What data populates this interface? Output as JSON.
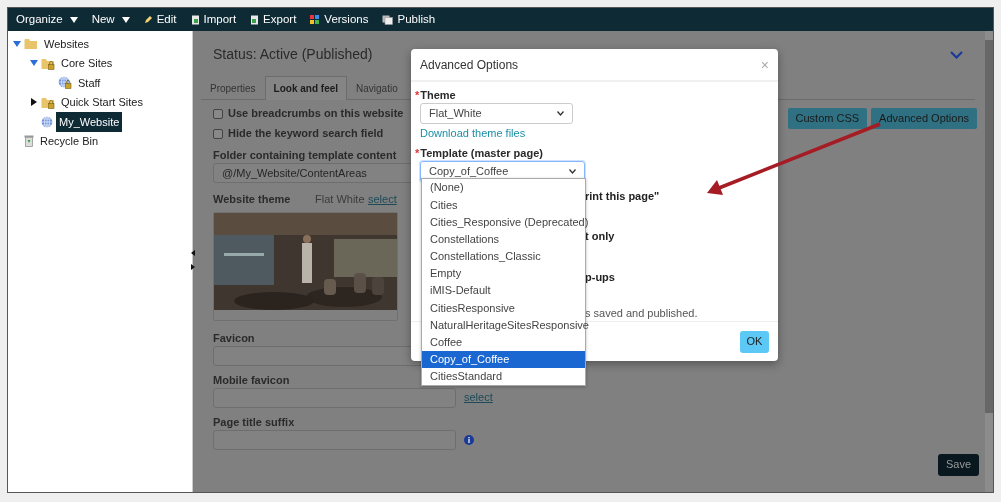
{
  "toolbar": [
    {
      "label": "Organize",
      "kind": "dropdown"
    },
    {
      "label": "New",
      "kind": "dropdown"
    },
    {
      "label": "Edit",
      "kind": "edit"
    },
    {
      "label": "Import",
      "kind": "import"
    },
    {
      "label": "Export",
      "kind": "export"
    },
    {
      "label": "Versions",
      "kind": "versions"
    },
    {
      "label": "Publish",
      "kind": "publish"
    }
  ],
  "tree": [
    {
      "label": "Websites",
      "kind": "folder",
      "expanded": true,
      "selected": false,
      "children": [
        {
          "label": "Core Sites",
          "kind": "locked-folder",
          "expanded": true,
          "selected": false,
          "children": [
            {
              "label": "Staff",
              "kind": "locked-globe",
              "selected": false
            }
          ]
        },
        {
          "label": "Quick Start Sites",
          "kind": "locked-folder",
          "expanded": false,
          "selected": false
        },
        {
          "label": "My_Website",
          "kind": "globe",
          "selected": true
        }
      ]
    },
    {
      "label": "Recycle Bin",
      "kind": "recycle",
      "selected": false
    }
  ],
  "status": "Status: Active (Published)",
  "tabs": [
    {
      "label": "Properties",
      "selected": false
    },
    {
      "label": "Look and feel",
      "selected": true
    },
    {
      "label": "Navigatio",
      "selected": false
    }
  ],
  "action_buttons": [
    "Custom CSS",
    "Advanced Options"
  ],
  "checkboxes": [
    {
      "label": "Use breadcrumbs on this website",
      "checked": false
    },
    {
      "label": "Hide the keyword search field",
      "checked": false
    }
  ],
  "folder_field": {
    "label": "Folder containing template content",
    "value": "@/My_Website/ContentAreas"
  },
  "website_theme": {
    "label": "Website theme",
    "value": "Flat White",
    "link": "select"
  },
  "favicon": {
    "label": "Favicon"
  },
  "mobile_favicon": {
    "label": "Mobile favicon",
    "link": "select"
  },
  "page_title_suffix": {
    "label": "Page title suffix"
  },
  "save_button": "Save",
  "modal": {
    "title": "Advanced Options",
    "close": "×",
    "theme": {
      "label": "Theme",
      "required_mark": "*",
      "value": "Flat_White"
    },
    "download_link": "Download theme files",
    "template": {
      "label": "Template (master page)",
      "required_mark": "*",
      "value": "Copy_of_Coffee",
      "expanded": true,
      "options": [
        {
          "label": "(None)",
          "selected": false
        },
        {
          "label": "Cities",
          "selected": false
        },
        {
          "label": "Cities_Responsive (Deprecated)",
          "selected": false
        },
        {
          "label": "Constellations",
          "selected": false
        },
        {
          "label": "Constellations_Classic",
          "selected": false
        },
        {
          "label": "Empty",
          "selected": false
        },
        {
          "label": "iMIS-Default",
          "selected": false
        },
        {
          "label": "CitiesResponsive",
          "selected": false
        },
        {
          "label": "NaturalHeritageSitesResponsive",
          "selected": false
        },
        {
          "label": "Coffee",
          "selected": false
        },
        {
          "label": "Copy_of_Coffee",
          "selected": true
        },
        {
          "label": "CitiesStandard",
          "selected": false
        }
      ]
    },
    "partly_hidden_texts": [
      {
        "text": "rint this page\"",
        "kind": "label"
      },
      {
        "text": "t only",
        "kind": "label"
      },
      {
        "text": "p-ups",
        "kind": "label"
      },
      {
        "text": "s saved and published.",
        "kind": "note"
      }
    ],
    "ok_button": "OK"
  }
}
